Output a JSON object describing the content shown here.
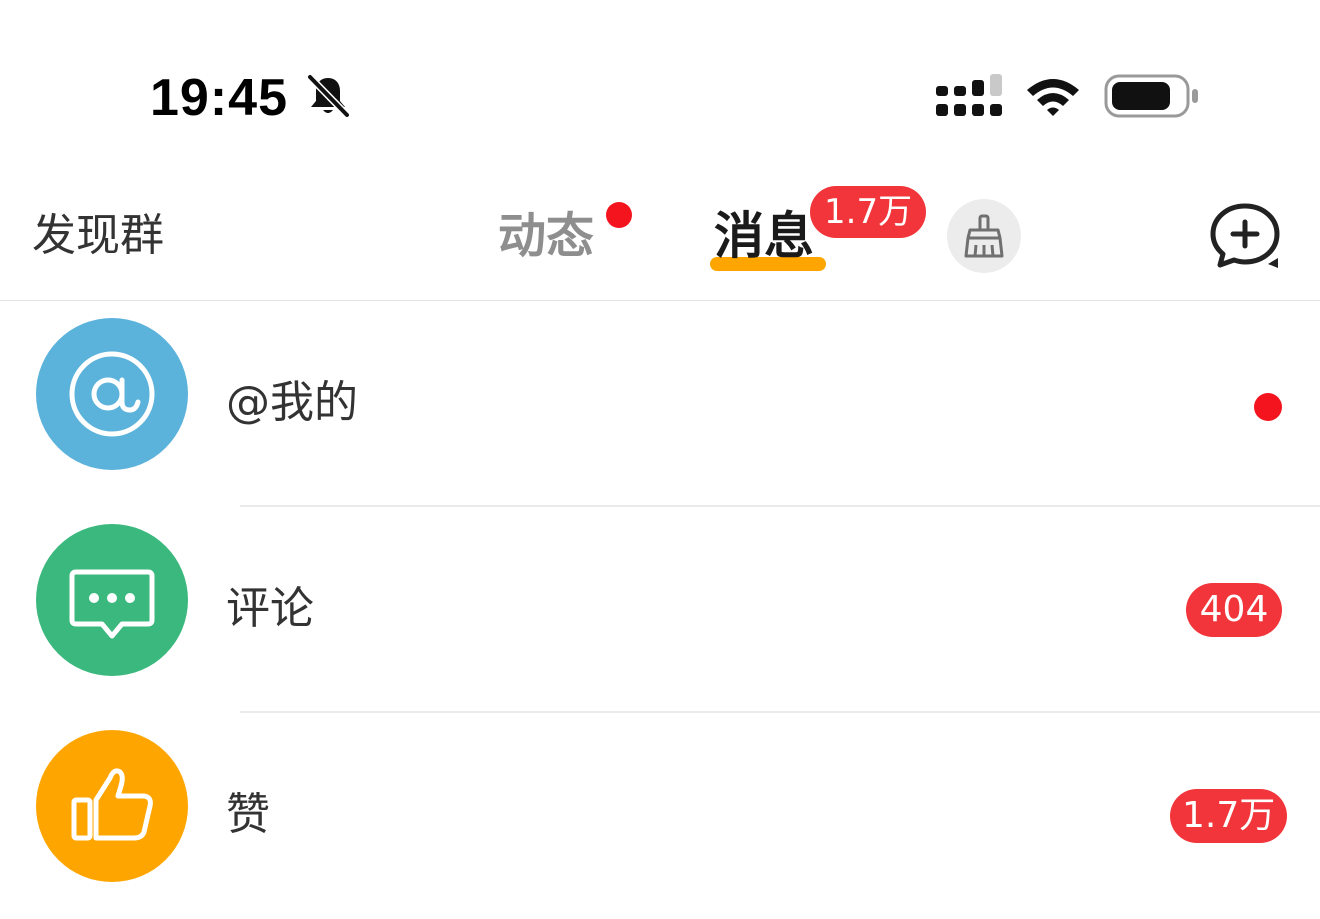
{
  "status_bar": {
    "time": "19:45",
    "icons": [
      "bell-muted-icon",
      "cellular-signal-icon",
      "wifi-icon",
      "battery-icon"
    ]
  },
  "header": {
    "discover_groups": "发现群",
    "tabs": [
      {
        "label": "动态",
        "has_dot": true,
        "active": false
      },
      {
        "label": "消息",
        "badge": "1.7万",
        "active": true
      }
    ],
    "icons": [
      "broom-icon",
      "add-chat-icon"
    ]
  },
  "message_items": [
    {
      "label": "@我的",
      "icon": "at-sign-icon",
      "color": "#5bb2db",
      "indicator": "dot"
    },
    {
      "label": "评论",
      "icon": "comment-icon",
      "color": "#3bb87e",
      "badge": "404"
    },
    {
      "label": "赞",
      "icon": "thumbs-up-icon",
      "color": "#ffa500",
      "badge": "1.7万"
    }
  ],
  "colors": {
    "accent_orange": "#ffa500",
    "badge_red": "#f2353a",
    "dot_red": "#f4141e"
  }
}
